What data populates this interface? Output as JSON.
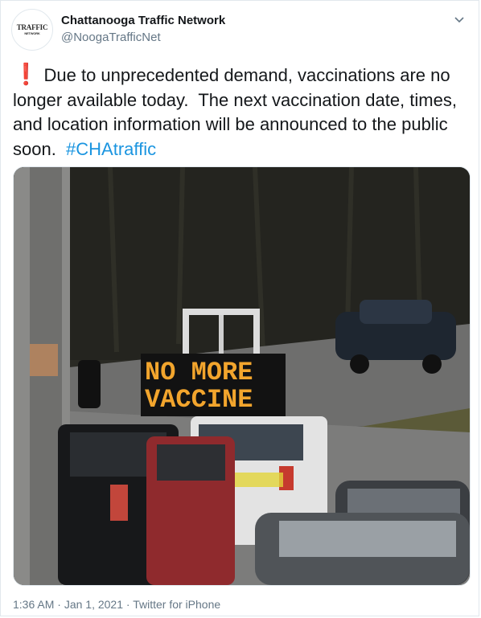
{
  "account": {
    "display_name": "Chattanooga Traffic Network",
    "handle": "@NoogaTrafficNet",
    "avatar_logo_text": "TRAFFIC",
    "avatar_logo_sub": "NETWORK"
  },
  "tweet": {
    "emoji": "❗",
    "body": " Due to unprecedented demand, vaccinations are no longer available today.  The next vaccination date, times, and location information will be announced to the public soon.  ",
    "hashtag": "#CHAtraffic"
  },
  "media": {
    "sign_line1": "NO MORE",
    "sign_line2": "VACCINE",
    "colors": {
      "trees": "#262620",
      "road": "#6d6d6c",
      "grass": "#5d5b3a",
      "sign_text": "#f2a52d"
    }
  },
  "meta": {
    "time": "1:36 AM",
    "date": "Jan 1, 2021",
    "source": "Twitter for iPhone"
  },
  "icons": {
    "caret": "chevron-down-icon"
  }
}
